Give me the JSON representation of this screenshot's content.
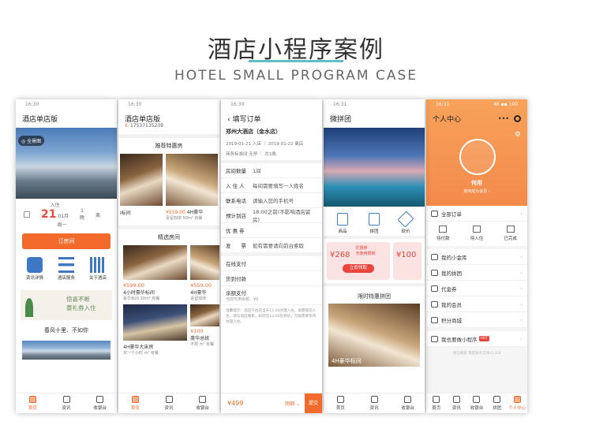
{
  "header": {
    "title": "酒店小程序案例",
    "subtitle": "HOTEL SMALL PROGRAM CASE"
  },
  "phone1": {
    "time": "16:30",
    "title": "酒店单店版",
    "pano": "全景图",
    "checkin_label": "入住",
    "checkin_day": "21",
    "checkin_month": "01月",
    "checkin_week": "周一",
    "nights": "1",
    "nights_unit": "晚",
    "checkout_label": "离",
    "book": "订房间",
    "icons": [
      "资讯详情",
      "酒店服务",
      "关于酒店"
    ],
    "banner_text": "惊喜不断\n豪礼券入住",
    "poem": "春风十里、不如你",
    "tabs": [
      "首页",
      "资讯",
      "收银台"
    ]
  },
  "phone2": {
    "time": "16:30",
    "title": "酒店单店版",
    "phone": "17537135239",
    "rec_title": "推荐特惠房",
    "rec_left_name": "I标间",
    "rec_right_price": "¥559.00",
    "rec_right_name": "4H豪华",
    "rec_right_desc": "喜留双床 50m² 有餐",
    "sel_title": "精选房间",
    "room1_price": "¥599.00",
    "room1_name": "4小时豪华标间",
    "room1_desc": "豪华标间 30m² 有餐",
    "room2_price": "¥559.00",
    "room2_name": "4H豪华",
    "room2_desc": "喜留双床",
    "room3_name": "4H豪华大床房",
    "room3_desc": "买一个小时 m² 有餐",
    "room4_price": "¥100",
    "room4_name": "豪华总统",
    "room4_desc": "不限 m² 有餐",
    "tabs": [
      "首页",
      "资讯",
      "收银台"
    ]
  },
  "phone3": {
    "time": "16:30",
    "title": "填写订单",
    "hotel": "郑州大酒店（金水店）",
    "date_in": "2019-01-21 入店",
    "date_out": "2019-01-22 离店",
    "room_type": "商务标准间 无早",
    "count": "共1晚",
    "rows": [
      {
        "label": "房间数量",
        "value": "1间"
      },
      {
        "label": "入 住 人",
        "value": "每间需要填写一人姓名"
      },
      {
        "label": "联系电话",
        "value": "请输入您的手机号"
      },
      {
        "label": "预计到店",
        "value": "18:00之前(不影响酒店留房)"
      },
      {
        "label": "优 惠 券",
        "value": ""
      },
      {
        "label": "发　　票",
        "value": "如有需要请向前台索取"
      }
    ],
    "pay": [
      "在线支付",
      "货到付款",
      "余额支付"
    ],
    "balance": "当前可用余额：¥0",
    "tip": "温馨提示：酒店于住店当天13:00办理入住，如需提前入住，请与酒店联系。如您在13:00前到达，可能需要等待办理入住。",
    "total": "¥499",
    "detail": "明细",
    "submit": "提交"
  },
  "phone4": {
    "time": "16:31",
    "title": "微拼团",
    "cats": [
      "商品",
      "拼团",
      "砍价"
    ],
    "coupon1_amt": "¥268",
    "coupon1_t1": "优惠券",
    "coupon1_t2": "无使用限制",
    "coupon2_amt": "¥100",
    "get": "立即领取",
    "sale_title": "限时特惠拼团",
    "item": "4H豪华标间",
    "tabs": [
      "首页",
      "资讯",
      "收银台"
    ]
  },
  "phone5": {
    "time": "16:31",
    "signal": "46 ▪▪ 100",
    "title": "个人中心",
    "name": "何用",
    "become": "如何成为会员 ›",
    "orders": "全部订单",
    "order_tabs": [
      "待付款",
      "待入住",
      "已完成"
    ],
    "menu": [
      "我的小金库",
      "我的拼团",
      "代金券",
      "我的会员",
      "积分商城"
    ],
    "mini": "我也要做小程序",
    "hot": "HOT",
    "footer": "微信搜索 我是技术支持v1.8.8",
    "tabs": [
      "首页",
      "资讯",
      "收银台",
      "拼团",
      "个人中心"
    ]
  }
}
